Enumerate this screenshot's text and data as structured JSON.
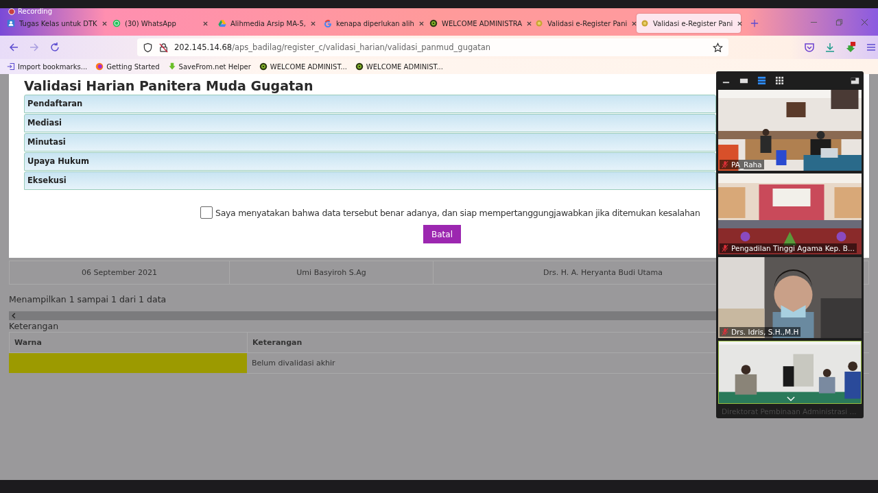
{
  "recording_label": "Recording",
  "tabs": [
    {
      "kind": "person",
      "title": "Tugas Kelas untuk DTK",
      "selected": false
    },
    {
      "kind": "whatsapp",
      "title": "(30) WhatsApp",
      "selected": false
    },
    {
      "kind": "drive",
      "title": "Alihmedia Arsip MA-5,",
      "selected": false
    },
    {
      "kind": "google",
      "title": "kenapa diperlukan alih",
      "selected": false
    },
    {
      "kind": "shield",
      "title": "WELCOME ADMINISTRA",
      "selected": false
    },
    {
      "kind": "coin",
      "title": "Validasi e-Register Pani",
      "selected": false
    },
    {
      "kind": "coin",
      "title": "Validasi e-Register Pani",
      "selected": true
    }
  ],
  "address_bar": {
    "host": "202.145.14.68",
    "path": "/aps_badilag/register_c/validasi_harian/validasi_panmud_gugatan"
  },
  "bookmarks": [
    {
      "kind": "import",
      "label": "Import bookmarks..."
    },
    {
      "kind": "firefox",
      "label": "Getting Started"
    },
    {
      "kind": "download",
      "label": "SaveFrom.net Helper"
    },
    {
      "kind": "shield",
      "label": "WELCOME ADMINIST..."
    },
    {
      "kind": "shield",
      "label": "WELCOME ADMINIST..."
    }
  ],
  "modal": {
    "title": "Validasi Harian Panitera Muda Gugatan",
    "sections": [
      "Pendaftaran",
      "Mediasi",
      "Minutasi",
      "Upaya Hukum",
      "Eksekusi"
    ],
    "agreement": {
      "text": "Saya menyatakan bahwa data tersebut benar adanya, dan siap mempertanggungjawabkan jika ditemukan kesalahan",
      "checked": false
    },
    "cancel_button": "Batal"
  },
  "table_row": [
    "06 September 2021",
    "Umi Basyiroh S.Ag",
    "Drs. H. A. Heryanta Budi Utama"
  ],
  "info_text": "Menampilkan 1 sampai 1 dari 1 data",
  "legend": {
    "title": "Keterangan",
    "columns": [
      "Warna",
      "Keterangan"
    ],
    "rows": [
      {
        "color": "#9c9a00",
        "text": "Belum divalidasi akhir"
      }
    ]
  },
  "video_panel": {
    "participants": [
      {
        "name": "PA_Raha",
        "muted": true,
        "active": false
      },
      {
        "name": "Pengadilan Tinggi Agama Kep. B...",
        "muted": true,
        "active": false
      },
      {
        "name": "Drs. Idris, S.H.,M.H",
        "muted": true,
        "active": false
      },
      {
        "name": "Direktorat Pembinaan Administrasi ...",
        "muted": false,
        "active": true
      }
    ]
  }
}
